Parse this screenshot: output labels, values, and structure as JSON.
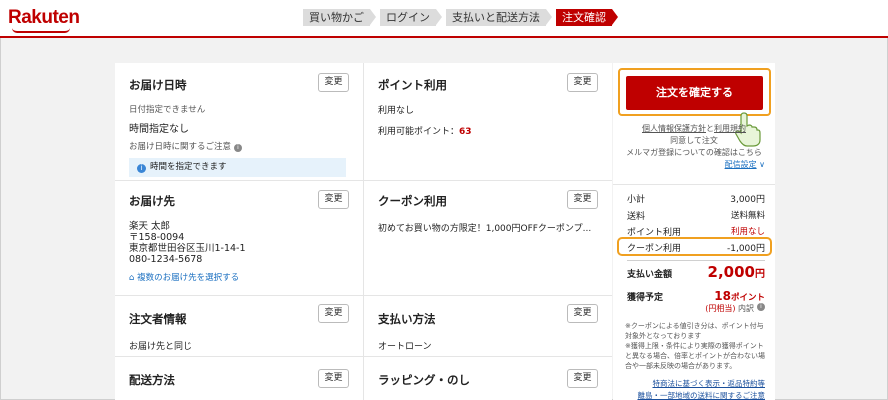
{
  "header": {
    "logo": "Rakuten",
    "steps": [
      "買い物かご",
      "ログイン",
      "支払いと配送方法",
      "注文確認"
    ]
  },
  "delivery_date": {
    "title": "お届け日時",
    "change": "変更",
    "note": "日付指定できません",
    "value": "時間指定なし",
    "caution": "お届け日時に関するご注意",
    "info": "時間を指定できます"
  },
  "points": {
    "title": "ポイント利用",
    "change": "変更",
    "value": "利用なし",
    "available_label": "利用可能ポイント：",
    "available_value": "63"
  },
  "address": {
    "title": "お届け先",
    "change": "変更",
    "name": "楽天 太郎",
    "zip": "〒158-0094",
    "line": "東京都世田谷区玉川1-14-1",
    "phone": "080-1234-5678",
    "select_link": "複数のお届け先を選択する"
  },
  "coupon": {
    "title": "クーポン利用",
    "change": "変更",
    "value": "初めてお買い物の方限定！1,000円OFFクーポンプ..."
  },
  "orderer": {
    "title": "注文者情報",
    "change": "変更",
    "value": "お届け先と同じ"
  },
  "payment": {
    "title": "支払い方法",
    "change": "変更",
    "value": "オートローン"
  },
  "shipping": {
    "title": "配送方法",
    "change": "変更"
  },
  "wrapping": {
    "title": "ラッピング・のし",
    "change": "変更"
  },
  "side": {
    "confirm": "注文を確定する",
    "privacy": "個人情報保護方針",
    "and": "と",
    "terms": "利用規約",
    "agree": "同意して注文",
    "mail_note": "メルマガ登録についての確認はこちら",
    "delivery_settings": "配信設定",
    "subtotal_label": "小計",
    "subtotal_value": "3,000円",
    "shipping_label": "送料",
    "shipping_value": "送料無料",
    "points_label": "ポイント利用",
    "points_value": "利用なし",
    "coupon_label": "クーポン利用",
    "coupon_value": "-1,000円",
    "total_label": "支払い金額",
    "total_value": "2,000",
    "total_unit": "円",
    "earn_label": "獲得予定",
    "earn_value": "18",
    "earn_unit": "ポイント",
    "earn_note": "(円相当)",
    "earn_detail": "内訳",
    "fine1": "※クーポンによる値引き分は、ポイント付与対象外となっております",
    "fine2": "※獲得上限・条件により実際の獲得ポイントと異なる場合、倍率とポイントが合わない場合や一部未反映の場合があります。",
    "link1": "特商法に基づく表示・返品特約等",
    "link2": "離島・一部地域の送料に関するご注意"
  },
  "colors": {
    "brand": "#bf0000",
    "highlight": "#f0a020",
    "link": "#1a6fc0"
  }
}
